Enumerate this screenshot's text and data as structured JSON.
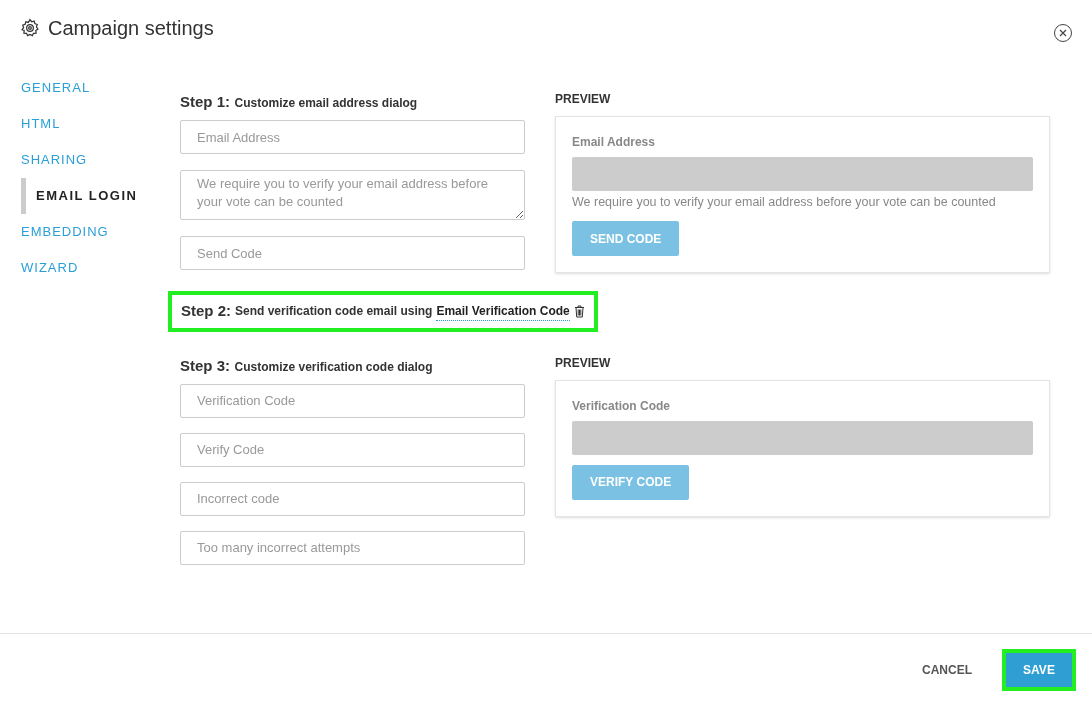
{
  "window": {
    "title": "Campaign settings"
  },
  "nav": [
    {
      "label": "GENERAL",
      "selected": false
    },
    {
      "label": "HTML",
      "selected": false
    },
    {
      "label": "SHARING",
      "selected": false
    },
    {
      "label": "EMAIL LOGIN",
      "selected": true
    },
    {
      "label": "EMBEDDING",
      "selected": false
    },
    {
      "label": "WIZARD",
      "selected": false
    }
  ],
  "step1": {
    "label": "Step 1:",
    "text": "Customize email address dialog",
    "fields": [
      {
        "kind": "input",
        "placeholder": "Email Address"
      },
      {
        "kind": "textarea",
        "placeholder": "We require you to verify your email address before your vote can be counted"
      },
      {
        "kind": "input",
        "placeholder": "Send Code"
      }
    ],
    "preview": {
      "heading": "PREVIEW",
      "label": "Email Address",
      "message": "We require you to verify your email address before your vote can be counted",
      "button": "SEND CODE"
    }
  },
  "step2": {
    "label": "Step 2:",
    "text": "Send verification code email using",
    "link": "Email Verification Code",
    "highlighted": true
  },
  "step3": {
    "label": "Step 3:",
    "text": "Customize verification code dialog",
    "fields": [
      {
        "kind": "input",
        "placeholder": "Verification Code"
      },
      {
        "kind": "input",
        "placeholder": "Verify Code"
      },
      {
        "kind": "input",
        "placeholder": "Incorrect code"
      },
      {
        "kind": "input",
        "placeholder": "Too many incorrect attempts"
      }
    ],
    "preview": {
      "heading": "PREVIEW",
      "label": "Verification Code",
      "button": "VERIFY CODE"
    }
  },
  "footer": {
    "cancel": "CANCEL",
    "save": "SAVE",
    "save_highlighted": true
  }
}
